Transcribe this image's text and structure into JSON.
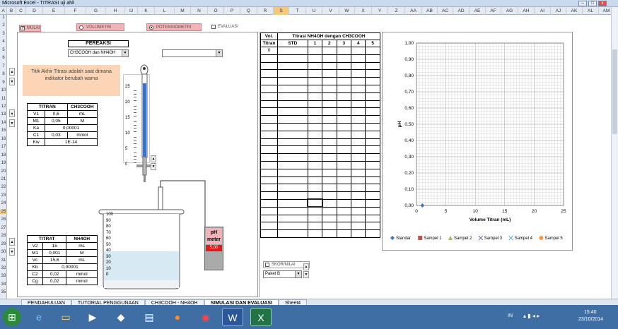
{
  "window": {
    "title": "Microsoft Excel - TITRASI uji ahli",
    "min": "–",
    "max": "□",
    "close": "x"
  },
  "columns": [
    "A",
    "B",
    "C",
    "D",
    "E",
    "F",
    "G",
    "H",
    "IJ",
    "K",
    "L",
    "M",
    "N",
    "O",
    "P",
    "Q",
    "R",
    "S",
    "T",
    "U",
    "V",
    "W",
    "X",
    "Y",
    "Z",
    "AA",
    "AB",
    "AC",
    "AD",
    "AE",
    "AF",
    "AG",
    "AH",
    "AI",
    "AJ",
    "AK",
    "AL",
    "AM",
    "AN"
  ],
  "rows": [
    "1",
    "2",
    "3",
    "4",
    "5",
    "6",
    "7",
    "8",
    "9",
    "10",
    "11",
    "12",
    "13",
    "14",
    "15",
    "16",
    "17",
    "18",
    "19",
    "20",
    "21",
    "22",
    "23",
    "24",
    "25",
    "26",
    "27",
    "28",
    "29",
    "30",
    "31",
    "32",
    "33",
    "34",
    "35"
  ],
  "mode": {
    "mulai": "MULAI",
    "volumetri": "VOLUMETRI",
    "potensiometri": "POTENSIOMETRI",
    "evaluasi": "EVALUASI"
  },
  "pereaksi": {
    "title": "PEREAKSI",
    "selected": "CH3COOH dan NH4OH",
    "second": ""
  },
  "note": "Titik Akhir Titrasi adalah saat dimana indikator berubah warna",
  "titran": {
    "h1": "TITRAN",
    "h2": "CH3COOH",
    "rows": [
      [
        "V1",
        "0,6",
        "mL"
      ],
      [
        "M1",
        "0,05",
        "M"
      ],
      [
        "Ka",
        "0,00001",
        ""
      ],
      [
        "C1",
        "0,03",
        "mmol"
      ],
      [
        "Kw",
        "1E-14",
        ""
      ]
    ]
  },
  "titrat": {
    "h1": "TITRAT",
    "h2": "NH4OH",
    "rows": [
      [
        "V2",
        "15",
        "mL"
      ],
      [
        "M1",
        "0,001",
        "M"
      ],
      [
        "Vc",
        "15,6",
        "mL"
      ],
      [
        "Kb",
        "0,00001",
        ""
      ],
      [
        "C2",
        "0,02",
        "mmol"
      ],
      [
        "Cg",
        "0,02",
        "mmol"
      ]
    ]
  },
  "buret_ticks": [
    "25",
    "20",
    "15",
    "10",
    "5",
    "0"
  ],
  "beaker_ticks": [
    "100",
    "90",
    "80",
    "70",
    "60",
    "50",
    "40",
    "30",
    "20",
    "10",
    "0"
  ],
  "phmeter": {
    "label1": "pH",
    "label2": "meter",
    "value": "5,00"
  },
  "datatable": {
    "h_vol": "Vol.",
    "h_titran": "Titran",
    "title": "Titrasi NH4OH dengan CH3COOH",
    "cols": [
      "STD",
      "1",
      "2",
      "3",
      "4",
      "5"
    ],
    "first": "0"
  },
  "skor": {
    "label": "SKOR/NILAI",
    "paket": "Paket B"
  },
  "chart_data": {
    "type": "scatter",
    "xlabel": "Volume Titran (mL)",
    "ylabel": "pH",
    "xlim": [
      0,
      25
    ],
    "ylim": [
      0,
      1
    ],
    "xticks": [
      "0",
      "5",
      "10",
      "15",
      "20",
      "25"
    ],
    "yticks": [
      "0,00",
      "0,10",
      "0,20",
      "0,30",
      "0,40",
      "0,50",
      "0,60",
      "0,70",
      "0,80",
      "0,90",
      "1,00"
    ],
    "grid": true,
    "legend": "bottom",
    "series": [
      {
        "name": "Standar",
        "color": "#4472c4",
        "marker": "diamond",
        "x": [
          1
        ],
        "y": [
          0
        ]
      },
      {
        "name": "Sampel 1",
        "color": "#c0504d",
        "marker": "square",
        "x": [],
        "y": []
      },
      {
        "name": "Sampel 2",
        "color": "#9bbb59",
        "marker": "triangle",
        "x": [],
        "y": []
      },
      {
        "name": "Sampel 3",
        "color": "#8064a2",
        "marker": "x",
        "x": [],
        "y": []
      },
      {
        "name": "Sampel 4",
        "color": "#4bacc6",
        "marker": "x",
        "x": [],
        "y": []
      },
      {
        "name": "Sampel 5",
        "color": "#f79646",
        "marker": "circle",
        "x": [],
        "y": []
      }
    ]
  },
  "tabs": [
    "PENDAHULUAN",
    "TUTORIAL PENGGUNAAN",
    "CH3COOH - NH4OH",
    "SIMULASI DAN EVALUASI",
    "Sheet4"
  ],
  "taskbar": {
    "lang": "IN",
    "time": "15:40",
    "date": "23/10/2014"
  },
  "colors": {
    "accent": "#f2b3b6",
    "note": "#fbd5b5",
    "buret": "#3b73c6",
    "liquid": "#d7e9f3",
    "phscreen": "#e0191b"
  }
}
